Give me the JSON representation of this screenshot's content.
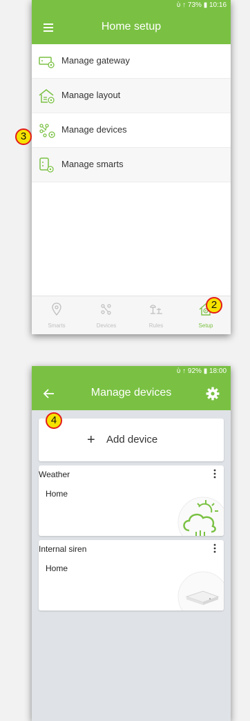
{
  "screen1": {
    "status": "ὺ  ↑ 73% ▮ 10:16",
    "title": "Home setup",
    "menu_items": [
      {
        "label": "Manage gateway",
        "icon": "gateway-icon"
      },
      {
        "label": "Manage layout",
        "icon": "layout-icon"
      },
      {
        "label": "Manage devices",
        "icon": "devices-icon"
      },
      {
        "label": "Manage smarts",
        "icon": "smarts-icon"
      }
    ],
    "nav_tabs": [
      {
        "label": "Smarts",
        "icon": "smarts-nav-icon"
      },
      {
        "label": "Devices",
        "icon": "devices-nav-icon"
      },
      {
        "label": "Rules",
        "icon": "rules-nav-icon"
      },
      {
        "label": "Setup",
        "icon": "setup-nav-icon",
        "active": true
      }
    ]
  },
  "screen2": {
    "status": "ὺ  ↑ 92% ▮ 18:00",
    "title": "Manage devices",
    "add_device_label": "Add device",
    "devices": [
      {
        "name": "Weather",
        "room": "Home",
        "icon": "weather-icon"
      },
      {
        "name": "Internal siren",
        "room": "Home",
        "icon": "siren-device-icon"
      }
    ]
  },
  "callouts": [
    "2",
    "3",
    "4"
  ],
  "colors": {
    "accent": "#7ac143",
    "badge_fill": "#f5e200",
    "badge_border": "#e21b1b"
  }
}
